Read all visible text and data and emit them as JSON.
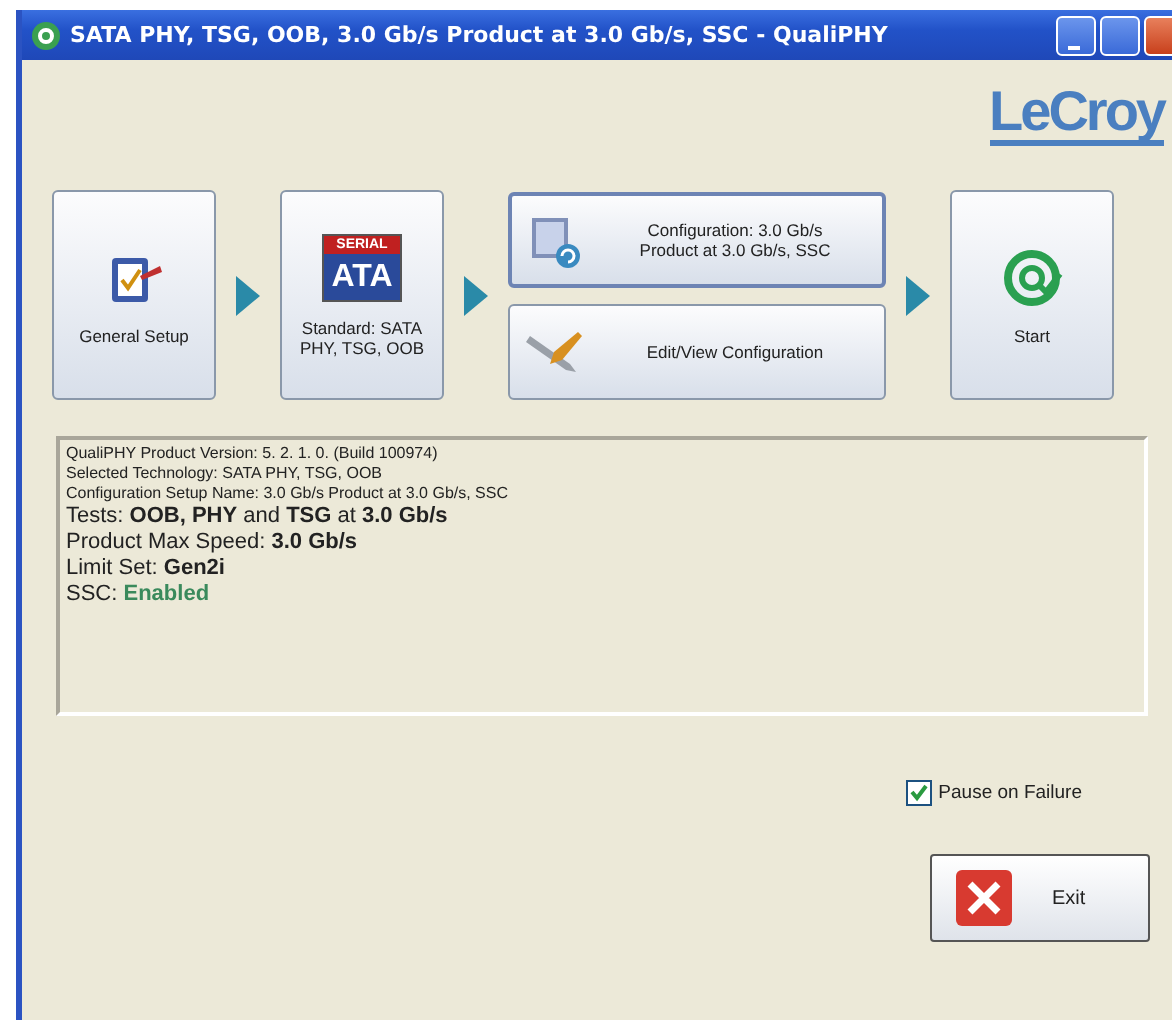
{
  "window": {
    "title": "SATA PHY, TSG, OOB, 3.0 Gb/s Product at 3.0 Gb/s, SSC - QualiPHY"
  },
  "logo": "LeCroy",
  "steps": [
    {
      "kind": "general",
      "label": "General Setup"
    },
    {
      "kind": "standard",
      "label": "Standard: SATA PHY, TSG, OOB",
      "badge_top": "SERIAL",
      "badge_main": "ATA"
    },
    {
      "kind": "config",
      "buttons": [
        {
          "kind": "config",
          "label": "Configuration: 3.0 Gb/s Product at 3.0 Gb/s, SSC"
        },
        {
          "kind": "edit",
          "label": "Edit/View Configuration"
        }
      ]
    },
    {
      "kind": "start",
      "label": "Start"
    }
  ],
  "info": [
    {
      "kind": "small",
      "text": "QualiPHY Product Version: 5. 2. 1. 0. (Build  100974)"
    },
    {
      "kind": "small",
      "text": "Selected Technology: SATA PHY, TSG, OOB"
    },
    {
      "kind": "small",
      "text": "Configuration Setup Name: 3.0 Gb/s Product at 3.0 Gb/s, SSC"
    },
    {
      "kind": "large",
      "text": "Tests: **OOB, PHY** and **TSG** at **3.0 Gb/s**"
    },
    {
      "kind": "large",
      "text": "Product Max Speed: **3.0 Gb/s**"
    },
    {
      "kind": "large",
      "text": "Limit Set: **Gen2i**"
    },
    {
      "kind": "large",
      "text": "SSC:",
      "status": {
        "text": "Enabled",
        "color": "#3a8a5c"
      }
    }
  ],
  "pause_on_failure": {
    "label": "Pause on Failure",
    "checked": true
  },
  "exit_button": {
    "label": "Exit"
  }
}
